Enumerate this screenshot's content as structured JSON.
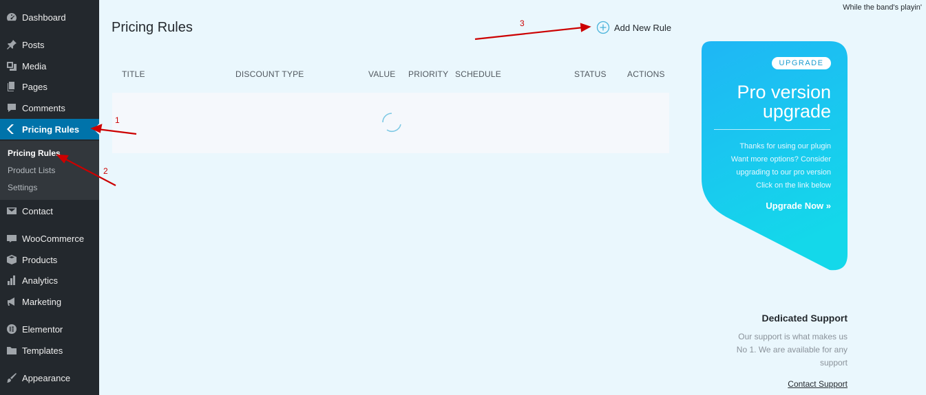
{
  "sidebar": {
    "items": [
      {
        "label": "Dashboard",
        "icon": "dashboard-icon"
      },
      {
        "label": "Posts",
        "icon": "pin-icon"
      },
      {
        "label": "Media",
        "icon": "media-icon"
      },
      {
        "label": "Pages",
        "icon": "pages-icon"
      },
      {
        "label": "Comments",
        "icon": "comment-icon"
      },
      {
        "label": "Pricing Rules",
        "icon": "chevron-left-icon"
      },
      {
        "label": "Contact",
        "icon": "mail-icon"
      },
      {
        "label": "WooCommerce",
        "icon": "woo-icon"
      },
      {
        "label": "Products",
        "icon": "box-icon"
      },
      {
        "label": "Analytics",
        "icon": "chart-bar-icon"
      },
      {
        "label": "Marketing",
        "icon": "megaphone-icon"
      },
      {
        "label": "Elementor",
        "icon": "elementor-icon"
      },
      {
        "label": "Templates",
        "icon": "folder-icon"
      },
      {
        "label": "Appearance",
        "icon": "brush-icon"
      }
    ],
    "submenu": [
      "Pricing Rules",
      "Product Lists",
      "Settings"
    ]
  },
  "header": {
    "title": "Pricing Rules",
    "add_rule": "Add New Rule",
    "corner_text": "While the band's playin'"
  },
  "table": {
    "columns": [
      "TITLE",
      "DISCOUNT TYPE",
      "VALUE",
      "PRIORITY",
      "SCHEDULE",
      "STATUS",
      "ACTIONS"
    ]
  },
  "annotations": [
    "1",
    "2",
    "3"
  ],
  "upgrade": {
    "badge": "UPGRADE",
    "title_line1": "Pro version",
    "title_line2": "upgrade",
    "text_lines": [
      "Thanks for using our plugin",
      "Want more options? Consider",
      "upgrading to our pro version",
      "Click on the link below"
    ],
    "link": "Upgrade Now »"
  },
  "support": {
    "title": "Dedicated Support",
    "text_lines": [
      "Our support is what makes us",
      "No 1. We are available for any",
      "support"
    ],
    "link": "Contact Support"
  },
  "colors": {
    "sidebar": "#23282d",
    "active": "#0073aa",
    "annotation": "#cc0000",
    "card_gradient_start": "#1fb6f5",
    "card_gradient_end": "#14d8ea"
  }
}
